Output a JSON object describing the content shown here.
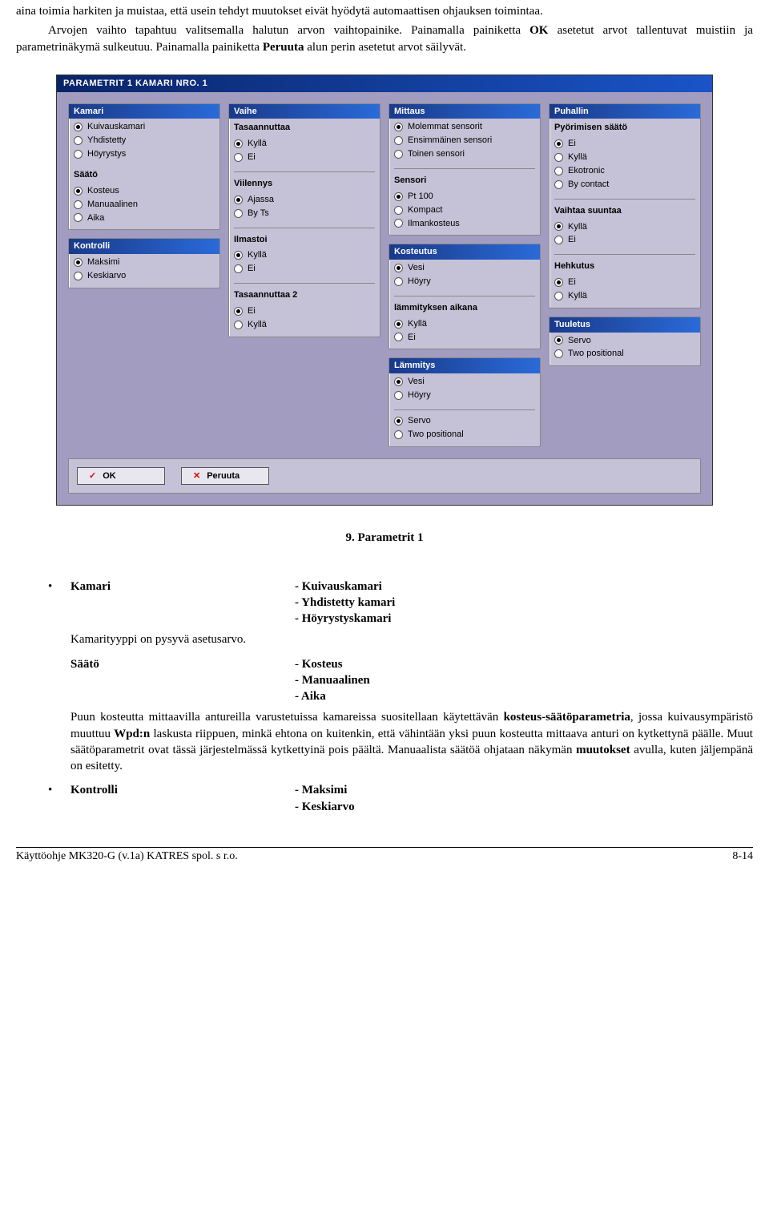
{
  "intro": {
    "p1": "aina toimia harkiten ja muistaa, että usein tehdyt muutokset eivät hyödytä automaattisen ohjauksen toimintaa.",
    "p2a": "Arvojen vaihto tapahtuu valitsemalla halutun arvon vaihtopainike. Painamalla painiketta ",
    "p2b": "OK",
    "p2c": " asetetut arvot tallentuvat muistiin ja parametrinäkymä sulkeutuu. Painamalla painiketta ",
    "p2d": "Peruuta",
    "p2e": " alun perin asetetut arvot säilyvät."
  },
  "dialog": {
    "title": "PARAMETRIT 1    KAMARI NRO. 1",
    "col1": {
      "kamari": {
        "title": "Kamari",
        "opts": [
          "Kuivauskamari",
          "Yhdistetty",
          "Höyrystys"
        ],
        "sel": 0
      },
      "saato": {
        "title": "Säätö",
        "opts": [
          "Kosteus",
          "Manuaalinen",
          "Aika"
        ],
        "sel": 0
      },
      "kontrolli": {
        "title": "Kontrolli",
        "opts": [
          "Maksimi",
          "Keskiarvo"
        ],
        "sel": 0
      }
    },
    "col2": {
      "vaihe": {
        "title": "Vaihe",
        "tasa": {
          "sub": "Tasaannuttaa",
          "opts": [
            "Kyllä",
            "Ei"
          ],
          "sel": 0
        },
        "viil": {
          "sub": "Viilennys",
          "opts": [
            "Ajassa",
            "By Ts"
          ],
          "sel": 0
        },
        "ilm": {
          "sub": "Ilmastoi",
          "opts": [
            "Kyllä",
            "Ei"
          ],
          "sel": 0
        },
        "tasa2": {
          "sub": "Tasaannuttaa 2",
          "opts": [
            "Ei",
            "Kyllä"
          ],
          "sel": 0
        }
      }
    },
    "col3": {
      "mittaus": {
        "title": "Mittaus",
        "m1": {
          "opts": [
            "Molemmat sensorit",
            "Ensimmäinen sensori",
            "Toinen sensori"
          ],
          "sel": 0
        },
        "sensori": {
          "sub": "Sensori",
          "opts": [
            "Pt 100",
            "Kompact",
            "Ilmankosteus"
          ],
          "sel": 0
        }
      },
      "kosteutus": {
        "title": "Kosteutus",
        "k1": {
          "opts": [
            "Vesi",
            "Höyry"
          ],
          "sel": 0
        },
        "lam": {
          "sub": "lämmityksen aikana",
          "opts": [
            "Kyllä",
            "Ei"
          ],
          "sel": 0
        }
      },
      "lammitys": {
        "title": "Lämmitys",
        "l1": {
          "opts": [
            "Vesi",
            "Höyry"
          ],
          "sel": 0
        },
        "l2": {
          "opts": [
            "Servo",
            "Two positional"
          ],
          "sel": 0
        }
      }
    },
    "col4": {
      "puhallin": {
        "title": "Puhallin",
        "pyor": {
          "sub": "Pyörimisen säätö",
          "opts": [
            "Ei",
            "Kyllä",
            "Ekotronic",
            "By contact"
          ],
          "sel": 0
        },
        "vaih": {
          "sub": "Vaihtaa suuntaa",
          "opts": [
            "Kyllä",
            "Ei"
          ],
          "sel": 0
        },
        "hehk": {
          "sub": "Hehkutus",
          "opts": [
            "Ei",
            "Kyllä"
          ],
          "sel": 0
        }
      },
      "tuuletus": {
        "title": "Tuuletus",
        "opts": [
          "Servo",
          "Two positional"
        ],
        "sel": 0
      }
    },
    "buttons": {
      "ok": "OK",
      "cancel": "Peruuta"
    }
  },
  "figcap": "9.        Parametrit 1",
  "content": {
    "kamari": {
      "name": "Kamari",
      "vals": [
        "- Kuivauskamari",
        "- Yhdistetty kamari",
        "- Höyrystyskamari"
      ]
    },
    "kamari_note": "Kamarityyppi on pysyvä asetusarvo.",
    "saato": {
      "name": "Säätö",
      "vals": [
        "- Kosteus",
        "- Manuaalinen",
        "- Aika"
      ]
    },
    "saato_p": {
      "a": "Puun kosteutta mittaavilla antureilla varustetuissa kamareissa suositellaan käytettävän ",
      "b": "kosteus-säätöparametria",
      "c": ", jossa kuivausympäristö muuttuu ",
      "d": "Wpd:n",
      "e": " laskusta riippuen, minkä ehtona on kuitenkin, että vähintään yksi puun kosteutta mittaava anturi on kytkettynä päälle. Muut säätöparametrit ovat tässä järjestelmässä kytkettyinä pois päältä. Manuaalista säätöä ohjataan näkymän ",
      "f": "muutokset",
      "g": " avulla, kuten jäljempänä on esitetty."
    },
    "kontrolli": {
      "name": "Kontrolli",
      "vals": [
        "- Maksimi",
        "- Keskiarvo"
      ]
    }
  },
  "footer": {
    "left": "Käyttöohje  MK320-G (v.1a)  KATRES spol. s r.o.",
    "right": "8-14"
  }
}
